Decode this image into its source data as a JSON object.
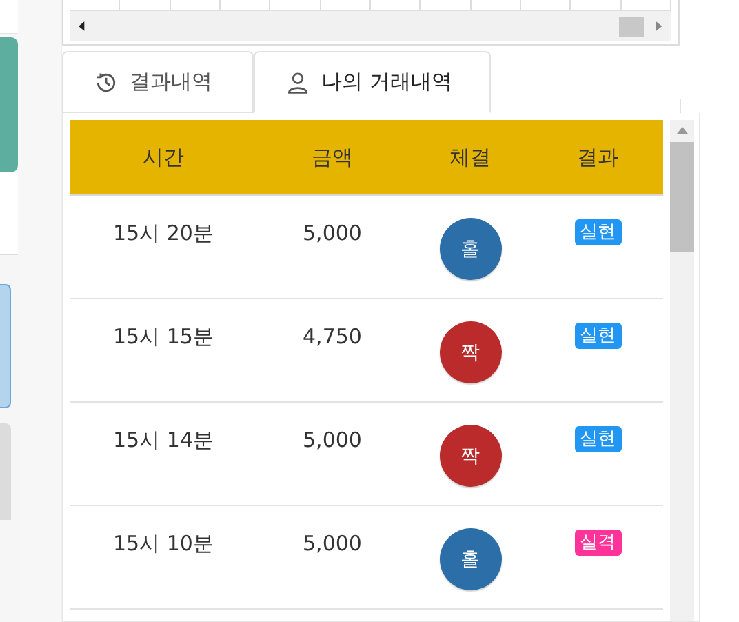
{
  "tabs": [
    {
      "label": "결과내역",
      "selected": false
    },
    {
      "label": "나의 거래내역",
      "selected": true
    }
  ],
  "table": {
    "columns": [
      "시간",
      "금액",
      "체결",
      "결과"
    ],
    "rows": [
      {
        "time": "15시 20분",
        "amount": "5,000",
        "pick": {
          "label": "홀",
          "color": "#2c6fa8"
        },
        "result": {
          "label": "실현",
          "color": "#2196f3"
        }
      },
      {
        "time": "15시 15분",
        "amount": "4,750",
        "pick": {
          "label": "짝",
          "color": "#bc2b2c"
        },
        "result": {
          "label": "실현",
          "color": "#2196f3"
        }
      },
      {
        "time": "15시 14분",
        "amount": "5,000",
        "pick": {
          "label": "짝",
          "color": "#bc2b2c"
        },
        "result": {
          "label": "실현",
          "color": "#2196f3"
        }
      },
      {
        "time": "15시 10분",
        "amount": "5,000",
        "pick": {
          "label": "홀",
          "color": "#2c6fa8"
        },
        "result": {
          "label": "실격",
          "color": "#ff3399"
        }
      }
    ]
  }
}
